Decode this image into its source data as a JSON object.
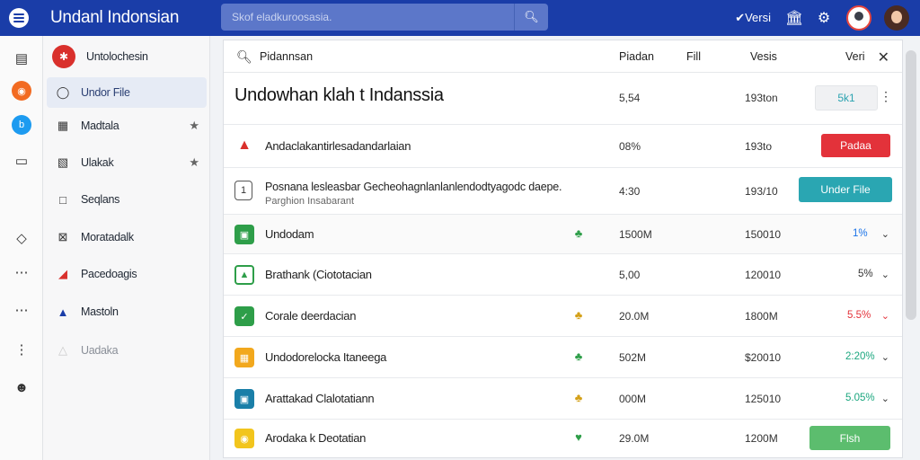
{
  "app": {
    "title": "Undanl Indonsian",
    "search_placeholder": "Skof eladkuroosasia.",
    "versions_label": "Versi",
    "colors": {
      "topbar": "#1a3da8",
      "accent_red": "#e3323a",
      "accent_teal": "#2aa6b2",
      "accent_green": "#5cbd6e"
    }
  },
  "rail": {
    "icons": [
      "document-icon",
      "rss-icon",
      "bing-icon",
      "crop-icon",
      "tag-icon",
      "more-horizontal-icon",
      "more-horizontal-icon",
      "more-vertical-icon",
      "user-icon"
    ]
  },
  "sidebar": {
    "items": [
      {
        "label": "Untolochesin",
        "icon": "asterisk-icon"
      },
      {
        "label": "Undor File",
        "icon": "circle-icon"
      },
      {
        "label": "Madtala",
        "icon": "calculator-icon"
      },
      {
        "label": "Ulakak",
        "icon": "clipboard-icon"
      },
      {
        "label": "Seqlans",
        "icon": "square-icon"
      },
      {
        "label": "Moratadalk",
        "icon": "back-icon"
      },
      {
        "label": "Pacedoagis",
        "icon": "chart-icon"
      },
      {
        "label": "Mastoln",
        "icon": "triangle-icon"
      },
      {
        "label": "Uadaka",
        "icon": "faded-icon"
      }
    ]
  },
  "table": {
    "search_label": "Pidannsan",
    "col_1": "Piadan",
    "col_2": "Fill",
    "col_3": "Vesis",
    "col_4": "Veri",
    "title_row": {
      "title": "Undowhan klah t Indanssia",
      "v1": "5,54",
      "v2": "193ton",
      "btn": "5k1"
    },
    "rows": [
      {
        "name": "Andaclakantirlesadandarlaian",
        "v1": "08%",
        "v2": "193to",
        "action": "Padaa"
      },
      {
        "line1": "Posnana lesleasbar Gecheohagnlanlanlendodtyagodc daepe.",
        "line2": "Parghion Insabarant",
        "v1": "4:30",
        "v2": "193/10",
        "action": "Under File"
      },
      {
        "name": "Undodam",
        "v1": "1500M",
        "v2": "150010",
        "pct": "1%"
      },
      {
        "name": "Brathank (Ciototacian",
        "v1": "5,00",
        "v2": "120010",
        "pct": "5%"
      },
      {
        "name": "Corale deerdacian",
        "v1": "20.0M",
        "v2": "1800M",
        "pct": "5.5%"
      },
      {
        "name": "Undodorelocka Itaneega",
        "v1": "502M",
        "v2": "$20010",
        "pct": "2:20%"
      },
      {
        "name": "Arattakad Clalotatiann",
        "v1": "000M",
        "v2": "125010",
        "pct": "5.05%"
      },
      {
        "name": "Arodaka k Deotatian",
        "v1": "29.0M",
        "v2": "1200M",
        "action": "Flsh"
      }
    ]
  }
}
